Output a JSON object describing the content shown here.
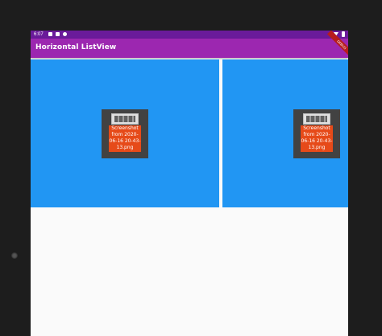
{
  "status_bar": {
    "time": "6:07"
  },
  "app_bar": {
    "title": "Horizontal ListView",
    "color": "#9c27b0",
    "debug_banner": "DEBUG"
  },
  "list": {
    "items": [
      {
        "thumbnail_caption": "Screenshot\nfrom 2020-\n06-16 20-43-\n13.png",
        "background": "#2196f3"
      },
      {
        "thumbnail_caption": "Screenshot\nfrom 2020-\n06-16 20-43-\n13.png",
        "background": "#2196f3"
      }
    ]
  }
}
